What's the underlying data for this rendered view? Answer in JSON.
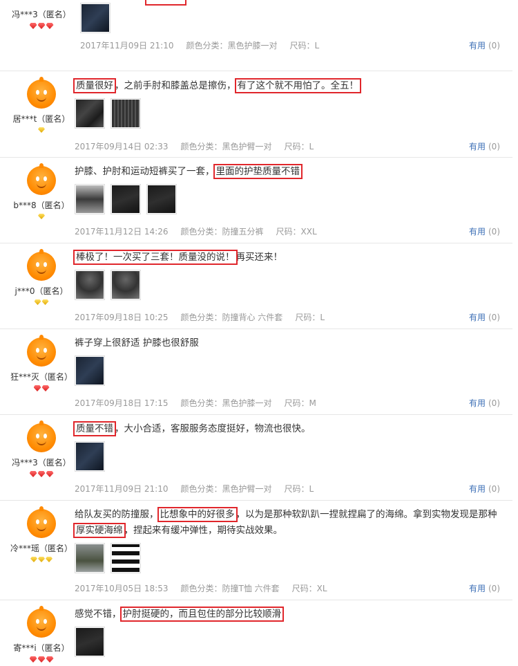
{
  "useful_label": "有用",
  "reviews": [
    {
      "user": "冯***3（匿名）",
      "text_html": "",
      "time": "2017年11月09日 21:10",
      "sku": "颜色分类：黑色护膝一对",
      "size": "尺码：L",
      "useful_count": "(0)"
    },
    {
      "user": "居***t（匿名）",
      "segments": [
        {
          "t": "质量很好",
          "hl": true
        },
        {
          "t": "，之前手肘和膝盖总是擦伤，",
          "hl": false
        },
        {
          "t": "有了这个就不用怕了。全五！",
          "hl": true
        }
      ],
      "time": "2017年09月14日 02:33",
      "sku": "颜色分类：黑色护臂一对",
      "size": "尺码：L",
      "useful_count": "(0)"
    },
    {
      "user": "b***8（匿名）",
      "segments": [
        {
          "t": "护膝、护肘和运动短裤买了一套，",
          "hl": false
        },
        {
          "t": "里面的护垫质量不错",
          "hl": true
        }
      ],
      "time": "2017年11月12日 14:26",
      "sku": "颜色分类：防撞五分裤",
      "size": "尺码：XXL",
      "useful_count": "(0)"
    },
    {
      "user": "j***0（匿名）",
      "segments": [
        {
          "t": "棒极了！一次买了三套！质量没的说！",
          "hl": true
        },
        {
          "t": "再买还来！",
          "hl": false
        }
      ],
      "time": "2017年09月18日 10:25",
      "sku": "颜色分类：防撞背心 六件套",
      "size": "尺码：L",
      "useful_count": "(0)"
    },
    {
      "user": "狂***灭（匿名）",
      "segments": [
        {
          "t": "裤子穿上很舒适 护膝也很舒服",
          "hl": false
        }
      ],
      "time": "2017年09月18日 17:15",
      "sku": "颜色分类：黑色护膝一对",
      "size": "尺码：M",
      "useful_count": "(0)"
    },
    {
      "user": "冯***3（匿名）",
      "segments": [
        {
          "t": "质量不错",
          "hl": true
        },
        {
          "t": "，大小合适，客服服务态度挺好，物流也很快。",
          "hl": false
        }
      ],
      "time": "2017年11月09日 21:10",
      "sku": "颜色分类：黑色护臂一对",
      "size": "尺码：L",
      "useful_count": "(0)"
    },
    {
      "user": "冷***瑶（匿名）",
      "line1": [
        {
          "t": "给队友买的防撞服，",
          "hl": false
        },
        {
          "t": "比想象中的好很多",
          "hl": true
        },
        {
          "t": "，以为是那种软趴趴一捏就捏扁了的海绵。拿到实物发现是那种",
          "hl": false
        }
      ],
      "line2": [
        {
          "t": "厚实硬海绵",
          "hl": true
        },
        {
          "t": "，捏起来有缓冲弹性，期待实战效果。",
          "hl": false
        }
      ],
      "time": "2017年10月05日 18:53",
      "sku": "颜色分类：防撞T恤 六件套",
      "size": "尺码：XL",
      "useful_count": "(0)"
    },
    {
      "user": "寄***i（匿名）",
      "segments": [
        {
          "t": "感觉不错，",
          "hl": false
        },
        {
          "t": "护肘挺硬的，而且包住的部分比较顺滑",
          "hl": true
        }
      ]
    }
  ]
}
